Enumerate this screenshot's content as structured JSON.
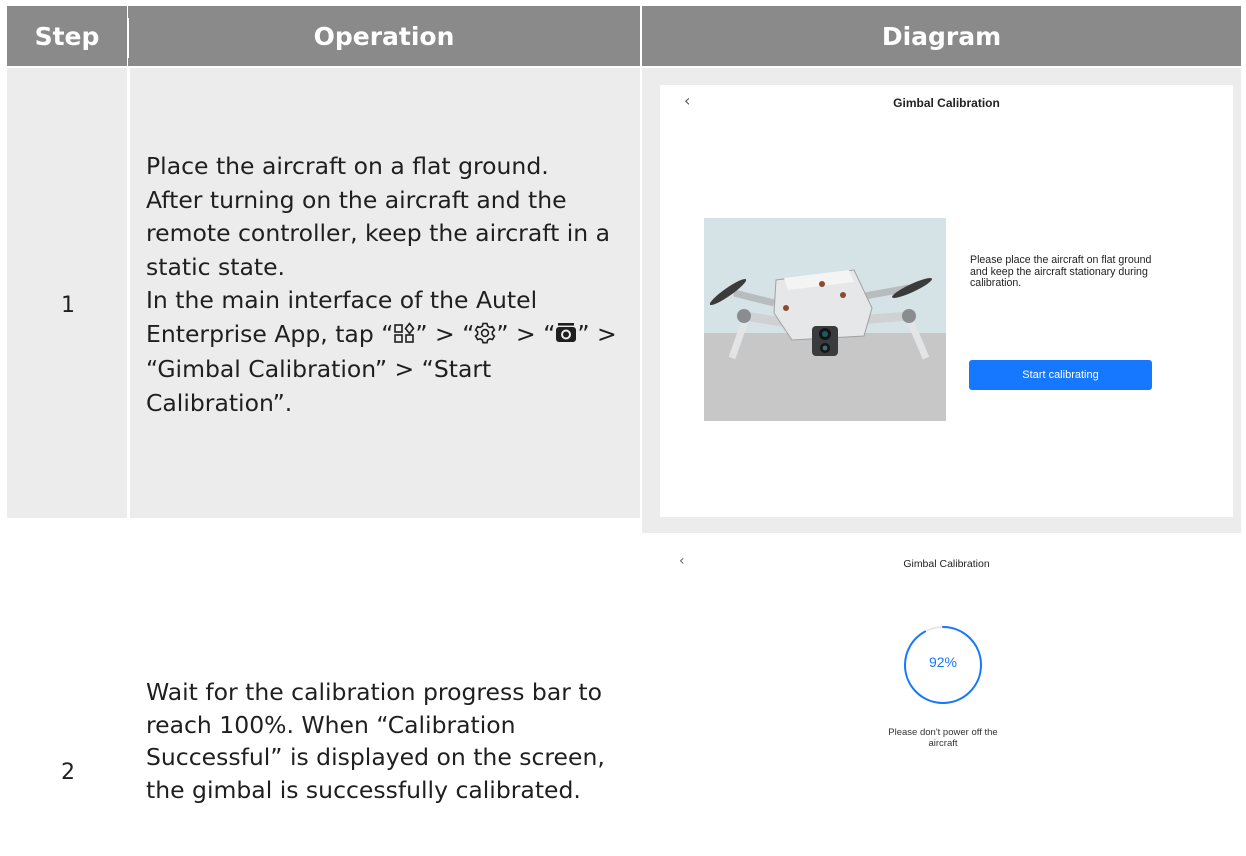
{
  "table": {
    "headers": {
      "step": "Step",
      "operation": "Operation",
      "diagram": "Diagram"
    },
    "rows": [
      {
        "step": "1",
        "operation": {
          "line1": "Place the aircraft on a flat ground.",
          "line2": "After turning on the aircraft and the remote controller, keep the aircraft in a static state.",
          "line3_prefix": "In the main interface of the Autel Enterprise App, tap “",
          "line3_sep1": "” > “",
          "line3_sep2": "” >",
          "line3_sep3_open": "“",
          "line3_tail": "” > “Gimbal Calibration” > “Start Calibration”.",
          "icons": [
            "apps-grid-icon",
            "settings-gear-icon",
            "gimbal-camera-icon"
          ]
        },
        "screen": {
          "back": "‹",
          "title": "Gimbal Calibration",
          "instruction": "Please place the aircraft on flat ground and keep the aircraft stationary during calibration.",
          "button": "Start calibrating"
        }
      },
      {
        "step": "2",
        "operation": {
          "text": "Wait for the calibration progress bar to reach 100%. When “Calibration Successful” is displayed on the screen, the gimbal is successfully calibrated."
        },
        "screen": {
          "back": "‹",
          "title": "Gimbal Calibration",
          "progress_label": "92%",
          "progress_fraction": 0.92,
          "warning": "Please don't power off the aircraft"
        }
      }
    ]
  },
  "colors": {
    "header_bg": "#8a8a8a",
    "row_bg": "#ececec",
    "accent": "#1677ff"
  }
}
